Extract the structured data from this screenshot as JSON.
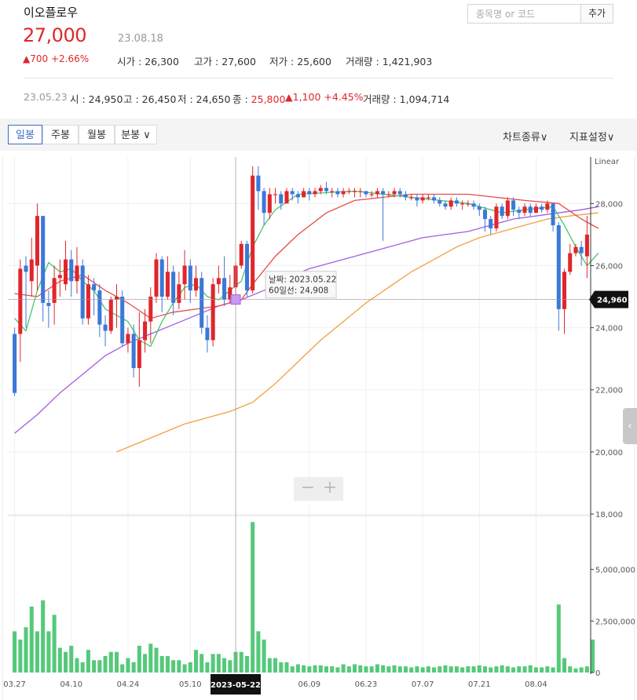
{
  "stock": {
    "name": "이오플로우",
    "price": "27,000",
    "date": "23.08.18",
    "change": "▲700 +2.66%",
    "stats": [
      {
        "label": "시가",
        "value": "26,300"
      },
      {
        "label": "고가",
        "value": "27,600"
      },
      {
        "label": "저가",
        "value": "25,600"
      },
      {
        "label": "거래량",
        "value": "1,421,903"
      }
    ]
  },
  "search": {
    "placeholder": "종목명 or 코드",
    "add_label": "추가"
  },
  "previous": {
    "date": "23.05.23",
    "open": "시 : 24,950",
    "high": "고 : 26,450",
    "low": "저 : 24,650",
    "close_label": "종 : ",
    "close_value": "25,800",
    "change": "▲1,100 +4.45%",
    "volume": "거래량 : 1,094,714"
  },
  "tabs": [
    {
      "label": "일봉",
      "active": true
    },
    {
      "label": "주봉",
      "active": false
    },
    {
      "label": "월봉",
      "active": false
    },
    {
      "label": "분봉 ∨",
      "active": false
    }
  ],
  "menu": {
    "chart_type": "차트종류∨",
    "indicator": "지표설정∨"
  },
  "colors": {
    "up": "#e0262b",
    "down": "#3b78d8",
    "ma5": "#4fc36b",
    "ma20": "#e64b4b",
    "ma60": "#a35de0",
    "ma120": "#f0a040",
    "volume": "#55c97a"
  },
  "chart_data": [
    {
      "type": "candlestick",
      "ylabel_scale": "Linear",
      "ylim": [
        18000,
        29500
      ],
      "y_ticks": [
        "28,000",
        "26,000",
        "24,000",
        "22,000",
        "20,000",
        "18,000"
      ],
      "x_ticks": [
        "03.27",
        "04.10",
        "04.24",
        "05.10",
        "05.22",
        "06.09",
        "06.23",
        "07.07",
        "07.21",
        "08.04"
      ],
      "crosshair": {
        "date_label": "날짜: 2023.05.22",
        "value_label": "60일선: 24,908",
        "price_tag": "24,960",
        "x_tag": "2023-05-22"
      },
      "candles": [
        [
          23800,
          21900,
          24000,
          21800
        ],
        [
          23800,
          25900,
          26200,
          22900
        ],
        [
          26000,
          25800,
          26300,
          24000
        ],
        [
          25500,
          26200,
          26900,
          25000
        ],
        [
          26000,
          27600,
          28000,
          25200
        ],
        [
          27600,
          24800,
          27600,
          24200
        ],
        [
          24800,
          24700,
          25200,
          24000
        ],
        [
          24800,
          25600,
          26000,
          24100
        ],
        [
          25600,
          25700,
          26200,
          25000
        ],
        [
          25400,
          26200,
          26800,
          25200
        ],
        [
          26200,
          25500,
          26500,
          25000
        ],
        [
          25500,
          26000,
          26600,
          25100
        ],
        [
          26000,
          24300,
          26200,
          24100
        ],
        [
          24300,
          25400,
          25700,
          24100
        ],
        [
          25400,
          25200,
          25600,
          24400
        ],
        [
          25200,
          24100,
          25400,
          23700
        ],
        [
          24100,
          23900,
          24400,
          23400
        ],
        [
          23900,
          24900,
          25000,
          23800
        ],
        [
          24900,
          25000,
          25400,
          24000
        ],
        [
          25000,
          23500,
          25200,
          23400
        ],
        [
          23500,
          23800,
          24000,
          23200
        ],
        [
          23800,
          22700,
          24100,
          22400
        ],
        [
          22700,
          23600,
          24500,
          22100
        ],
        [
          23600,
          24200,
          24600,
          23200
        ],
        [
          24200,
          25000,
          25300,
          23500
        ],
        [
          25000,
          26200,
          26400,
          24800
        ],
        [
          26200,
          25000,
          26300,
          24500
        ],
        [
          25000,
          25800,
          26300,
          24900
        ],
        [
          25800,
          24800,
          26000,
          24400
        ],
        [
          24800,
          25400,
          25800,
          24600
        ],
        [
          25400,
          26000,
          26500,
          24900
        ],
        [
          26000,
          25200,
          26200,
          24800
        ],
        [
          25200,
          25600,
          26000,
          25000
        ],
        [
          25600,
          24000,
          25800,
          23800
        ],
        [
          24000,
          23600,
          24400,
          23200
        ],
        [
          23600,
          25400,
          25600,
          23400
        ],
        [
          25400,
          25600,
          26000,
          25100
        ],
        [
          25600,
          24900,
          26300,
          24700
        ],
        [
          24900,
          25300,
          25700,
          24800
        ],
        [
          25300,
          26000,
          26100,
          25000
        ],
        [
          26000,
          26700,
          26800,
          25900
        ],
        [
          26700,
          25200,
          26800,
          25000
        ],
        [
          25200,
          28900,
          29200,
          25100
        ],
        [
          28900,
          28400,
          29200,
          27800
        ],
        [
          28400,
          27700,
          28500,
          27300
        ],
        [
          27700,
          28300,
          28500,
          27500
        ],
        [
          28300,
          28300,
          28500,
          28000
        ],
        [
          28300,
          28000,
          28400,
          27800
        ],
        [
          28000,
          28400,
          28500,
          28200
        ],
        [
          28400,
          28300,
          28500,
          28100
        ],
        [
          28300,
          28200,
          28400,
          28000
        ],
        [
          28200,
          28400,
          28500,
          28200
        ],
        [
          28400,
          28300,
          28500,
          28100
        ],
        [
          28300,
          28400,
          28500,
          28200
        ],
        [
          28400,
          28500,
          28600,
          28300
        ],
        [
          28500,
          28400,
          28700,
          28300
        ],
        [
          28400,
          28400,
          28500,
          28200
        ],
        [
          28400,
          28300,
          28500,
          28200
        ],
        [
          28300,
          28400,
          28500,
          28200
        ],
        [
          28400,
          28400,
          28500,
          28300
        ],
        [
          28400,
          28400,
          28500,
          28200
        ],
        [
          28400,
          28400,
          28500,
          28200
        ],
        [
          28400,
          28300,
          28400,
          28200
        ],
        [
          28300,
          28300,
          28400,
          28200
        ],
        [
          28300,
          28400,
          28500,
          28200
        ],
        [
          28400,
          28300,
          28500,
          26800
        ],
        [
          28300,
          28300,
          28400,
          28200
        ],
        [
          28300,
          28400,
          28500,
          28200
        ],
        [
          28400,
          28300,
          28500,
          28200
        ],
        [
          28300,
          28200,
          28400,
          28100
        ],
        [
          28200,
          28200,
          28300,
          28100
        ],
        [
          28200,
          28100,
          28300,
          27900
        ],
        [
          28100,
          28200,
          28300,
          28000
        ],
        [
          28200,
          28200,
          28300,
          28100
        ],
        [
          28200,
          28100,
          28300,
          28000
        ],
        [
          28100,
          28000,
          28200,
          27900
        ],
        [
          28000,
          27900,
          28100,
          27800
        ],
        [
          27900,
          28100,
          28200,
          27800
        ],
        [
          28100,
          28000,
          28200,
          27900
        ],
        [
          28000,
          28000,
          28100,
          27800
        ],
        [
          28000,
          28000,
          28100,
          27900
        ],
        [
          28000,
          27900,
          28100,
          27800
        ],
        [
          27900,
          27800,
          28000,
          27600
        ],
        [
          27800,
          27500,
          27900,
          27100
        ],
        [
          27500,
          27200,
          27600,
          27000
        ],
        [
          27200,
          27900,
          28000,
          27100
        ],
        [
          27900,
          27600,
          28000,
          27500
        ],
        [
          27600,
          28100,
          28200,
          27500
        ],
        [
          28100,
          27800,
          28200,
          27600
        ],
        [
          27800,
          27700,
          27900,
          27500
        ],
        [
          27700,
          27900,
          28000,
          27600
        ],
        [
          27900,
          27700,
          28000,
          27600
        ],
        [
          27700,
          27900,
          28000,
          27700
        ],
        [
          27900,
          27800,
          28000,
          27700
        ],
        [
          27800,
          28000,
          28100,
          27700
        ],
        [
          28000,
          27300,
          28000,
          27100
        ],
        [
          27300,
          24600,
          27400,
          23900
        ],
        [
          24600,
          25800,
          25900,
          23800
        ],
        [
          25800,
          26400,
          26700,
          25700
        ],
        [
          26400,
          26600,
          26700,
          26300
        ],
        [
          26600,
          26400,
          26800,
          26000
        ],
        [
          26300,
          27000,
          27600,
          25600
        ]
      ],
      "ma5": [
        [
          0,
          24300
        ],
        [
          2,
          23900
        ],
        [
          4,
          25200
        ],
        [
          6,
          26100
        ],
        [
          8,
          25800
        ],
        [
          10,
          25900
        ],
        [
          12,
          25500
        ],
        [
          14,
          25200
        ],
        [
          16,
          24600
        ],
        [
          18,
          24400
        ],
        [
          20,
          24200
        ],
        [
          22,
          23600
        ],
        [
          24,
          23400
        ],
        [
          26,
          24200
        ],
        [
          28,
          24800
        ],
        [
          30,
          25300
        ],
        [
          32,
          25400
        ],
        [
          34,
          25000
        ],
        [
          36,
          24900
        ],
        [
          38,
          25200
        ],
        [
          40,
          25500
        ],
        [
          42,
          26600
        ],
        [
          44,
          27300
        ],
        [
          46,
          27800
        ],
        [
          50,
          28300
        ],
        [
          60,
          28400
        ],
        [
          70,
          28200
        ],
        [
          80,
          28000
        ],
        [
          86,
          27700
        ],
        [
          90,
          27800
        ],
        [
          95,
          27900
        ],
        [
          97,
          27300
        ],
        [
          99,
          26600
        ],
        [
          101,
          26000
        ],
        [
          103,
          26400
        ]
      ],
      "ma20": [
        [
          0,
          25100
        ],
        [
          4,
          25000
        ],
        [
          8,
          25500
        ],
        [
          12,
          25700
        ],
        [
          16,
          25200
        ],
        [
          20,
          24800
        ],
        [
          24,
          24300
        ],
        [
          28,
          24500
        ],
        [
          32,
          24600
        ],
        [
          36,
          24700
        ],
        [
          40,
          24900
        ],
        [
          42,
          25400
        ],
        [
          46,
          26300
        ],
        [
          50,
          27000
        ],
        [
          55,
          27700
        ],
        [
          60,
          28100
        ],
        [
          70,
          28300
        ],
        [
          80,
          28300
        ],
        [
          90,
          28100
        ],
        [
          96,
          28000
        ],
        [
          100,
          27500
        ],
        [
          103,
          27200
        ]
      ],
      "ma60": [
        [
          0,
          20600
        ],
        [
          4,
          21200
        ],
        [
          8,
          21900
        ],
        [
          12,
          22500
        ],
        [
          16,
          23100
        ],
        [
          20,
          23500
        ],
        [
          24,
          23800
        ],
        [
          28,
          24100
        ],
        [
          32,
          24400
        ],
        [
          36,
          24700
        ],
        [
          40,
          24900
        ],
        [
          44,
          25200
        ],
        [
          48,
          25600
        ],
        [
          52,
          25900
        ],
        [
          56,
          26100
        ],
        [
          60,
          26300
        ],
        [
          64,
          26500
        ],
        [
          68,
          26700
        ],
        [
          72,
          26900
        ],
        [
          76,
          27000
        ],
        [
          80,
          27100
        ],
        [
          84,
          27300
        ],
        [
          88,
          27500
        ],
        [
          92,
          27600
        ],
        [
          96,
          27700
        ],
        [
          100,
          27800
        ],
        [
          103,
          27900
        ]
      ],
      "ma120": [
        [
          18,
          20000
        ],
        [
          22,
          20300
        ],
        [
          26,
          20600
        ],
        [
          30,
          20900
        ],
        [
          34,
          21100
        ],
        [
          38,
          21300
        ],
        [
          42,
          21600
        ],
        [
          46,
          22200
        ],
        [
          50,
          22900
        ],
        [
          54,
          23600
        ],
        [
          58,
          24200
        ],
        [
          62,
          24800
        ],
        [
          66,
          25300
        ],
        [
          70,
          25800
        ],
        [
          74,
          26200
        ],
        [
          78,
          26600
        ],
        [
          82,
          26900
        ],
        [
          86,
          27100
        ],
        [
          90,
          27300
        ],
        [
          94,
          27500
        ],
        [
          98,
          27600
        ],
        [
          103,
          27700
        ]
      ]
    },
    {
      "type": "bar",
      "y_ticks": [
        "5,000,000",
        "2,500,000",
        "0"
      ],
      "ylim": [
        0,
        7500000
      ],
      "values": [
        2000000,
        1600000,
        2200000,
        3200000,
        2000000,
        3500000,
        2000000,
        2800000,
        1200000,
        1000000,
        1300000,
        700000,
        500000,
        1100000,
        600000,
        600000,
        800000,
        1000000,
        1000000,
        400000,
        700000,
        500000,
        1300000,
        900000,
        1400000,
        1200000,
        800000,
        800000,
        600000,
        600000,
        400000,
        500000,
        1100000,
        900000,
        500000,
        900000,
        900000,
        700000,
        600000,
        1000000,
        1000000,
        800000,
        7300000,
        2000000,
        1600000,
        700000,
        700000,
        500000,
        500000,
        300000,
        400000,
        350000,
        300000,
        350000,
        350000,
        300000,
        300000,
        250000,
        400000,
        300000,
        400000,
        350000,
        300000,
        300000,
        400000,
        350000,
        300000,
        350000,
        300000,
        300000,
        250000,
        300000,
        250000,
        300000,
        250000,
        300000,
        350000,
        300000,
        300000,
        250000,
        300000,
        300000,
        350000,
        300000,
        250000,
        300000,
        350000,
        300000,
        250000,
        300000,
        300000,
        350000,
        250000,
        250000,
        300000,
        250000,
        3300000,
        700000,
        300000,
        200000,
        250000,
        300000,
        1600000
      ]
    }
  ]
}
